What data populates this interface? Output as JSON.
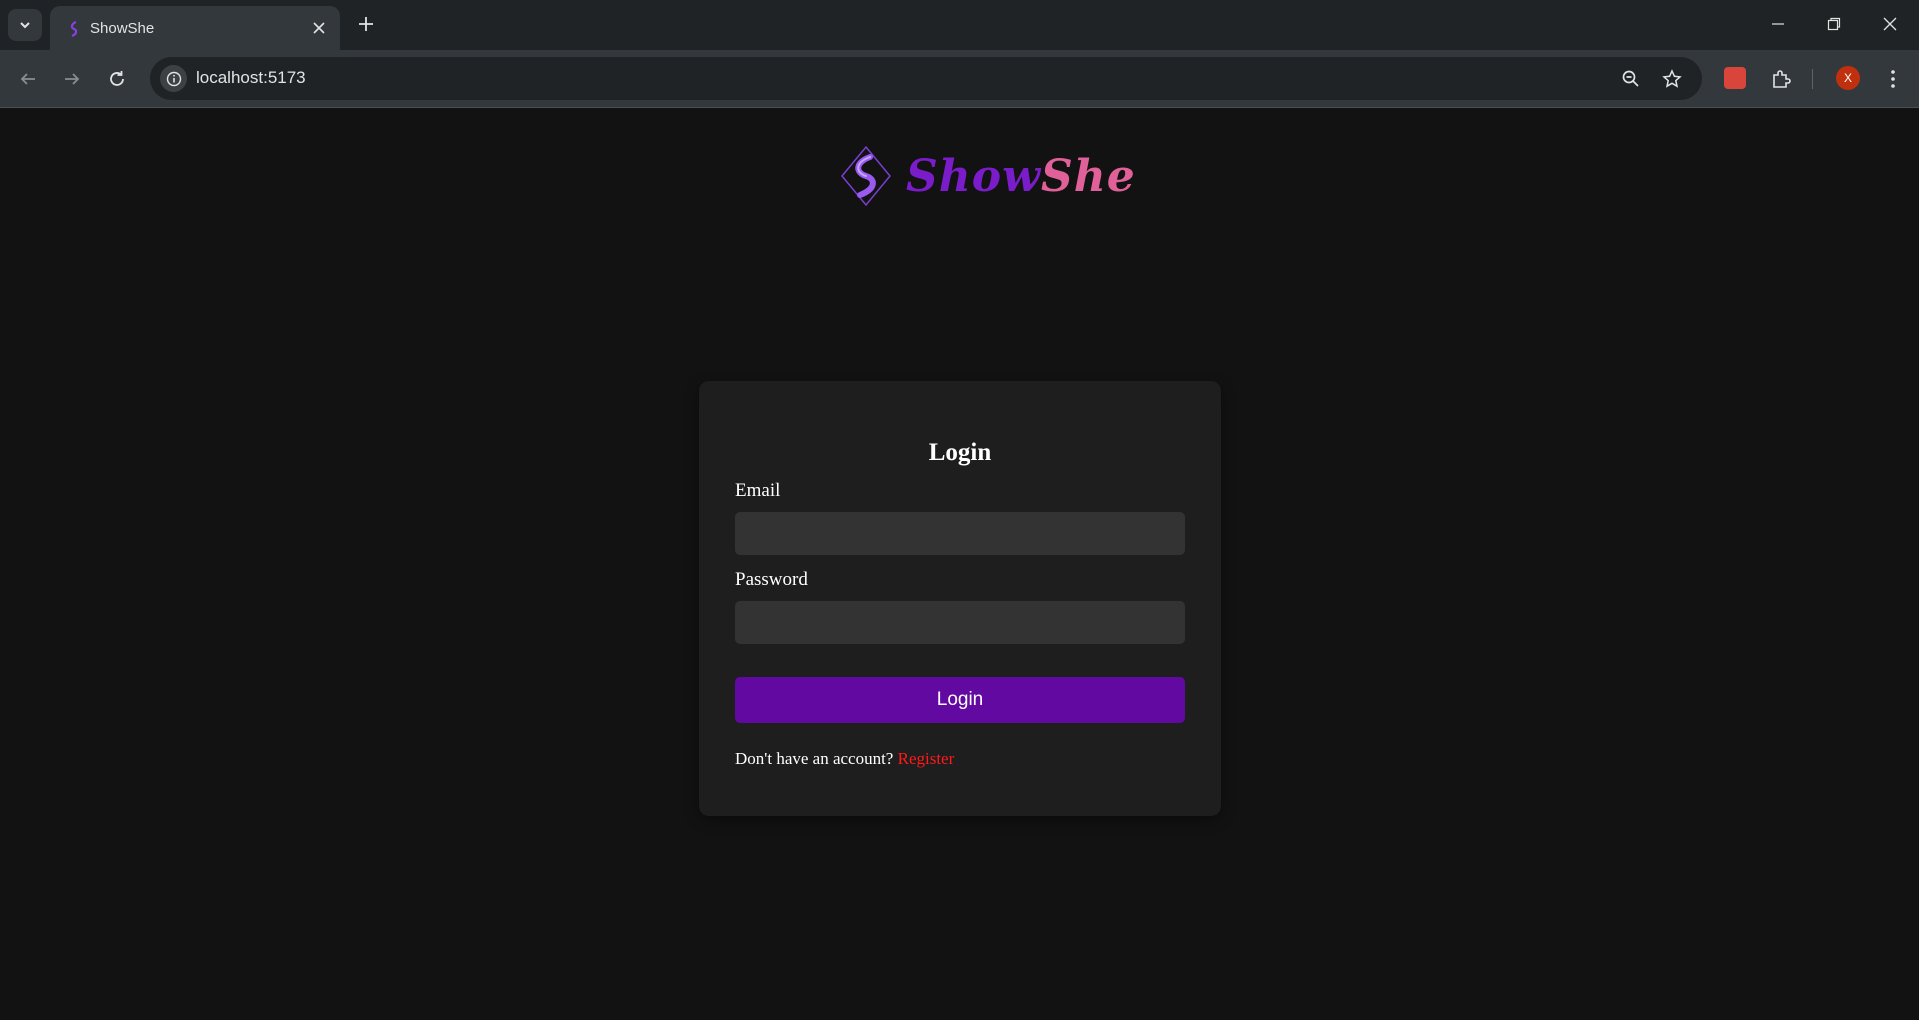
{
  "browser": {
    "tab_title": "ShowShe",
    "url": "localhost:5173",
    "profile_initial": "X"
  },
  "logo": {
    "word1": "Show",
    "word2": "She"
  },
  "login_form": {
    "title": "Login",
    "email_label": "Email",
    "email_value": "",
    "password_label": "Password",
    "password_value": "",
    "submit_label": "Login",
    "register_prompt": "Don't have an account?",
    "register_link": "Register"
  },
  "colors": {
    "accent_purple": "#6209a1",
    "register_red": "#ff1a1a",
    "logo_purple": "#7a1cc9",
    "logo_pink": "#e0609a"
  },
  "icons": [
    "tab-search-icon",
    "showshe-favicon-icon",
    "close-icon",
    "plus-icon",
    "minimize-icon",
    "restore-icon",
    "window-close-icon",
    "back-arrow-icon",
    "forward-arrow-icon",
    "reload-icon",
    "site-info-icon",
    "zoom-icon",
    "star-icon",
    "extension-icon",
    "puzzle-icon",
    "more-vert-icon"
  ]
}
